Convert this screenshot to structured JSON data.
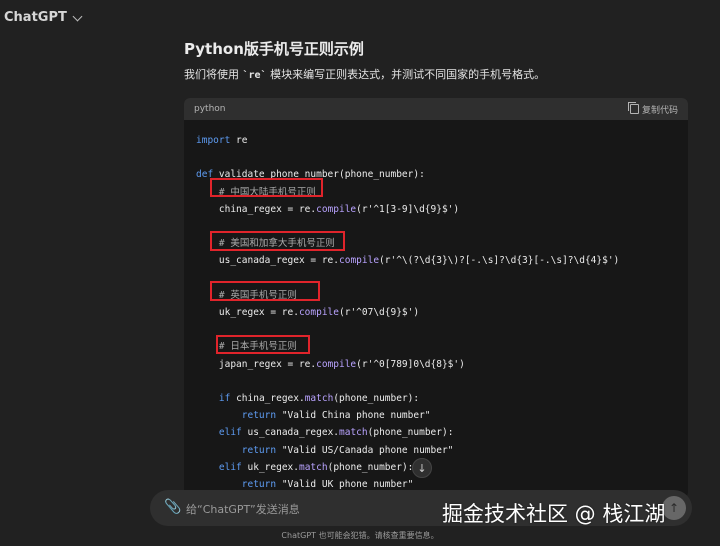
{
  "app": {
    "model_label": "ChatGPT"
  },
  "message": {
    "title": "Python版手机号正则示例",
    "intro": "我们将使用 `re` 模块来编写正则表达式，并测试不同国家的手机号格式。"
  },
  "code_block": {
    "language": "python",
    "copy_label": "复制代码",
    "lines": [
      "import re",
      "",
      "def validate_phone_number(phone_number):",
      "    # 中国大陆手机号正则",
      "    china_regex = re.compile(r'^1[3-9]\\d{9}$')",
      "",
      "    # 美国和加拿大手机号正则",
      "    us_canada_regex = re.compile(r'^\\(?\\d{3}\\)?[-.\\s]?\\d{3}[-.\\s]?\\d{4}$')",
      "",
      "    # 英国手机号正则",
      "    uk_regex = re.compile(r'^07\\d{9}$')",
      "",
      "    # 日本手机号正则",
      "    japan_regex = re.compile(r'^0[789]0\\d{8}$')",
      "",
      "    if china_regex.match(phone_number):",
      "        return \"Valid China phone number\"",
      "    elif us_canada_regex.match(phone_number):",
      "        return \"Valid US/Canada phone number\"",
      "    elif uk_regex.match(phone_number):",
      "        return \"Valid UK phone number\""
    ]
  },
  "composer": {
    "placeholder": "给“ChatGPT”发送消息"
  },
  "footer": {
    "disclaimer": "ChatGPT 也可能会犯错。请核查重要信息。"
  },
  "watermark": {
    "text": "掘金技术社区 @ 栈江湖"
  },
  "colors": {
    "background": "#212121",
    "code_bg": "#171717",
    "keyword": "#5e9cf3",
    "function": "#b9a3ff",
    "highlight_box": "#e0242b"
  }
}
